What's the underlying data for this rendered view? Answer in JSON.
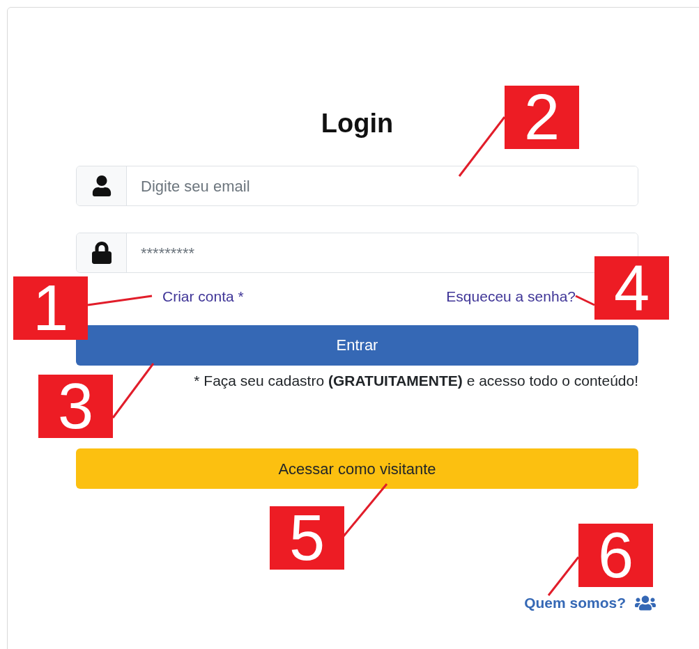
{
  "title": "Login",
  "email_field": {
    "placeholder": "Digite seu email"
  },
  "password_field": {
    "placeholder": "*********"
  },
  "links": [
    {
      "label": "Criar conta *"
    },
    {
      "label": "Esqueceu a senha?"
    }
  ],
  "login_button": {
    "label": "Entrar"
  },
  "signup_note": "* Faça seu cadastro **(GRATUITAMENTE)** e acesso todo o conteúdo!",
  "guest_button": {
    "label": "Acessar como visitante"
  },
  "about_link": {
    "label": "Quem somos?"
  },
  "callouts": [
    {
      "label": "1"
    },
    {
      "label": "2"
    },
    {
      "label": "3"
    },
    {
      "label": "4"
    },
    {
      "label": "5"
    },
    {
      "label": "6"
    }
  ]
}
